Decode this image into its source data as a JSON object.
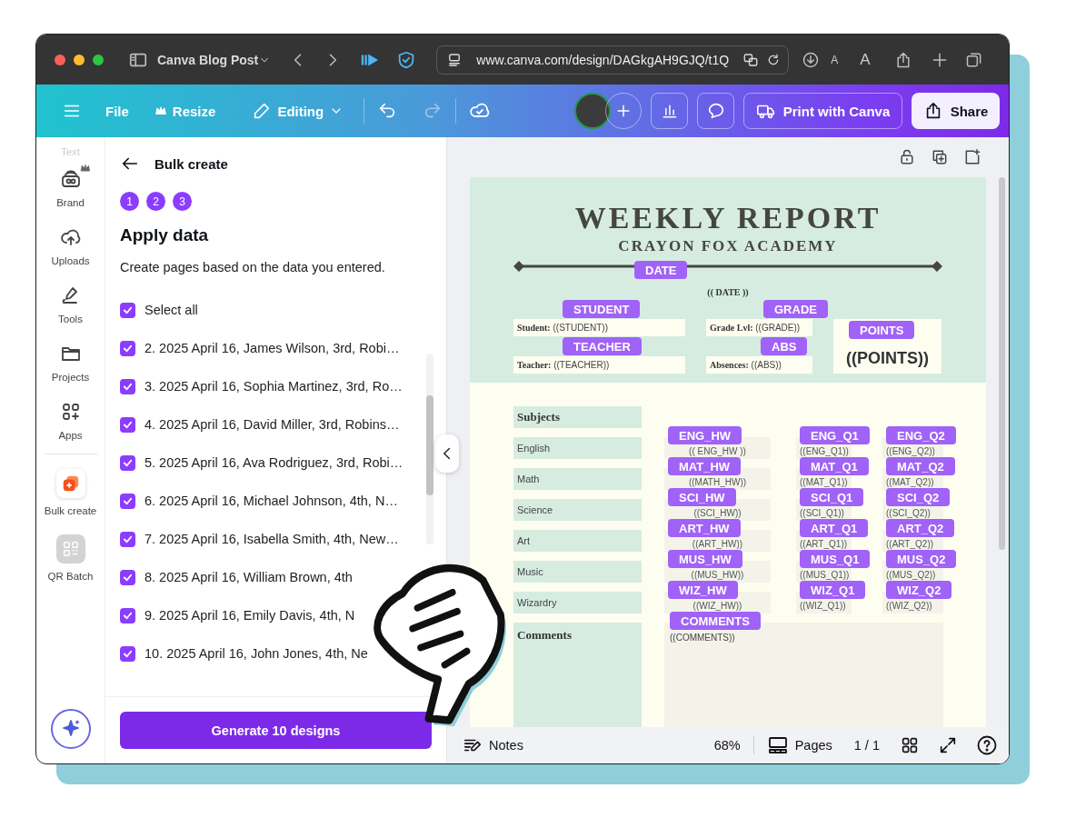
{
  "browser": {
    "title": "Canva Blog Post",
    "url": "www.canva.com/design/DAGkgAH9GJQ/t1Q",
    "text_small": "A",
    "text_large": "A"
  },
  "toolbar": {
    "file": "File",
    "resize": "Resize",
    "mode": "Editing",
    "print": "Print with Canva",
    "share": "Share"
  },
  "sidebar": {
    "items": [
      {
        "label": "Text",
        "kind": "faded"
      },
      {
        "label": "Brand",
        "kind": "brand"
      },
      {
        "label": "Uploads",
        "kind": "uploads"
      },
      {
        "label": "Tools",
        "kind": "tools"
      },
      {
        "label": "Projects",
        "kind": "projects"
      },
      {
        "label": "Apps",
        "kind": "apps"
      },
      {
        "label": "Bulk create",
        "kind": "bulk"
      },
      {
        "label": "QR Batch",
        "kind": "qr"
      }
    ]
  },
  "panel": {
    "title": "Bulk create",
    "steps": [
      "1",
      "2",
      "3"
    ],
    "heading": "Apply data",
    "description": "Create pages based on the data you entered.",
    "select_all": {
      "label": "Select all",
      "checked": true
    },
    "rows": [
      {
        "label": "2. 2025 April 16, James Wilson, 3rd, Robi…",
        "checked": true
      },
      {
        "label": "3. 2025 April 16, Sophia Martinez, 3rd, Ro…",
        "checked": true
      },
      {
        "label": "4. 2025 April 16, David Miller, 3rd, Robins…",
        "checked": true
      },
      {
        "label": "5. 2025 April 16, Ava Rodriguez, 3rd, Robi…",
        "checked": true
      },
      {
        "label": "6. 2025 April 16, Michael Johnson, 4th, N…",
        "checked": true
      },
      {
        "label": "7. 2025 April 16, Isabella Smith, 4th, New…",
        "checked": true
      },
      {
        "label": "8. 2025 April 16, William Brown, 4th",
        "checked": true
      },
      {
        "label": "9. 2025 April 16, Emily Davis, 4th, N",
        "checked": true
      },
      {
        "label": "10. 2025 April 16, John Jones, 4th, Ne",
        "checked": true
      }
    ],
    "button": "Generate 10 designs"
  },
  "design": {
    "title": "WEEKLY REPORT",
    "subtitle": "CRAYON FOX ACADEMY",
    "date": {
      "value": "(( DATE ))",
      "tag": "DATE"
    },
    "fields": [
      {
        "text": "**Student:** ((STUDENT))",
        "tag": "STUDENT"
      },
      {
        "text": "**Grade Lvl:** ((GRADE))",
        "tag": "GRADE"
      },
      {
        "text": "**Teacher:** ((TEACHER))",
        "tag": "TEACHER"
      },
      {
        "text": "**Absences:** ((ABS))",
        "tag": "ABS"
      }
    ],
    "points": {
      "value": "((POINTS))",
      "tag": "POINTS"
    },
    "subjects_header": "Subjects",
    "rows": [
      {
        "subject": "English",
        "cells": [
          {
            "value": "(( ENG_HW ))",
            "tag": "ENG_HW"
          },
          {
            "value": "((ENG_Q1))",
            "tag": "ENG_Q1"
          },
          {
            "value": "((ENG_Q2))",
            "tag": "ENG_Q2"
          }
        ]
      },
      {
        "subject": "Math",
        "cells": [
          {
            "value": "((MATH_HW))",
            "tag": "MAT_HW"
          },
          {
            "value": "((MAT_Q1))",
            "tag": "MAT_Q1"
          },
          {
            "value": "((MAT_Q2))",
            "tag": "MAT_Q2"
          }
        ]
      },
      {
        "subject": "Science",
        "cells": [
          {
            "value": "((SCI_HW))",
            "tag": "SCI_HW"
          },
          {
            "value": "((SCI_Q1))",
            "tag": "SCI_Q1"
          },
          {
            "value": "((SCI_Q2))",
            "tag": "SCI_Q2"
          }
        ]
      },
      {
        "subject": "Art",
        "cells": [
          {
            "value": "((ART_HW))",
            "tag": "ART_HW"
          },
          {
            "value": "((ART_Q1))",
            "tag": "ART_Q1"
          },
          {
            "value": "((ART_Q2))",
            "tag": "ART_Q2"
          }
        ]
      },
      {
        "subject": "Music",
        "cells": [
          {
            "value": "((MUS_HW))",
            "tag": "MUS_HW"
          },
          {
            "value": "((MUS_Q1))",
            "tag": "MUS_Q1"
          },
          {
            "value": "((MUS_Q2))",
            "tag": "MUS_Q2"
          }
        ]
      },
      {
        "subject": "Wizardry",
        "cells": [
          {
            "value": "((WIZ_HW))",
            "tag": "WIZ_HW"
          },
          {
            "value": "((WIZ_Q1))",
            "tag": "WIZ_Q1"
          },
          {
            "value": "((WIZ_Q2))",
            "tag": "WIZ_Q2"
          }
        ]
      }
    ],
    "comments": {
      "label": "Comments",
      "value": "((COMMENTS))",
      "tag": "COMMENTS"
    }
  },
  "footer": {
    "notes": "Notes",
    "zoom": "68%",
    "pages": "Pages",
    "page_count": "1 / 1"
  }
}
